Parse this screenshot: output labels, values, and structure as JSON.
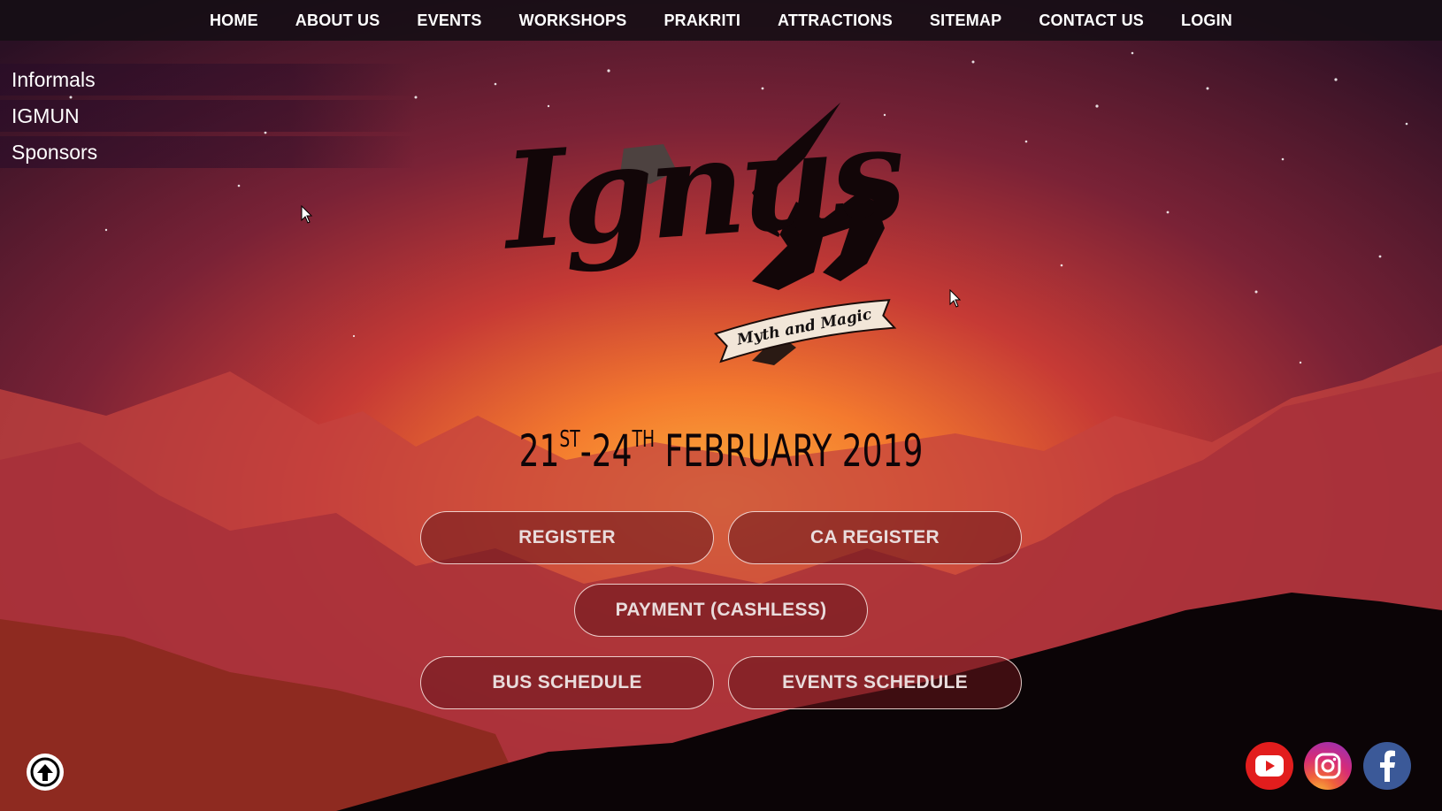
{
  "nav": {
    "items": [
      "HOME",
      "ABOUT US",
      "EVENTS",
      "WORKSHOPS",
      "PRAKRITI",
      "ATTRACTIONS",
      "SITEMAP",
      "CONTACT US",
      "LOGIN"
    ]
  },
  "side_menu": {
    "items": [
      "Informals",
      "IGMUN",
      "Sponsors"
    ]
  },
  "logo": {
    "word": "Ignus",
    "banner": "Myth and Magic"
  },
  "date": {
    "start_day": "21",
    "start_suffix": "ST",
    "separator": "-",
    "end_day": "24",
    "end_suffix": "TH",
    "month_year": "FEBRUARY 2019"
  },
  "buttons": {
    "register": "REGISTER",
    "ca_register": "CA REGISTER",
    "payment": "PAYMENT (CASHLESS)",
    "bus_schedule": "BUS SCHEDULE",
    "events_schedule": "EVENTS SCHEDULE"
  },
  "icons": {
    "back_to_top": "arrow-up-circle-icon",
    "youtube": "youtube-icon",
    "instagram": "instagram-icon",
    "facebook": "facebook-icon"
  },
  "colors": {
    "sky_top": "#2a1024",
    "sky_glow": "#f5a23a",
    "button_bg": "#69161c",
    "youtube": "#e21d1d",
    "facebook": "#3b5998"
  }
}
